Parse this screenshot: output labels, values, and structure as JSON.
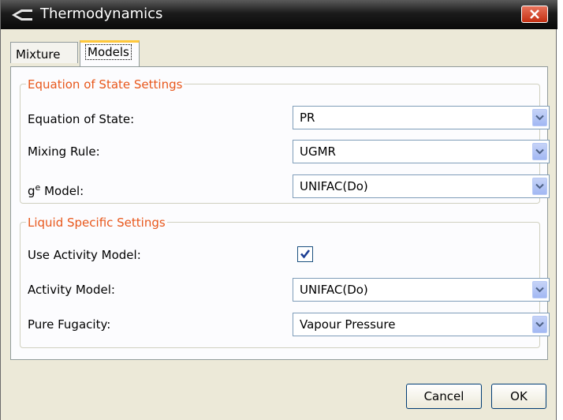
{
  "window": {
    "title": "Thermodynamics"
  },
  "tabs": {
    "mixture": "Mixture",
    "models": "Models"
  },
  "eos_group": {
    "legend": "Equation of State Settings",
    "equation_of_state": {
      "label": "Equation of State:",
      "value": "PR"
    },
    "mixing_rule": {
      "label": "Mixing Rule:",
      "value": "UGMR"
    },
    "ge_model": {
      "label_base": "g",
      "label_sup": "e",
      "label_rest": " Model:",
      "value": "UNIFAC(Do)"
    }
  },
  "liquid_group": {
    "legend": "Liquid Specific Settings",
    "use_activity_model": {
      "label": "Use Activity Model:",
      "checked": true
    },
    "activity_model": {
      "label": "Activity Model:",
      "value": "UNIFAC(Do)"
    },
    "pure_fugacity": {
      "label": "Pure Fugacity:",
      "value": "Vapour Pressure"
    }
  },
  "buttons": {
    "cancel": "Cancel",
    "ok": "OK"
  },
  "icons": {
    "app": "app-icon",
    "close": "close-icon",
    "dropdown": "chevron-down-icon",
    "check": "checkmark-icon"
  },
  "colors": {
    "legend": "#e8571b",
    "close": "#c42f12",
    "tab_highlight": "#ffc83c"
  }
}
